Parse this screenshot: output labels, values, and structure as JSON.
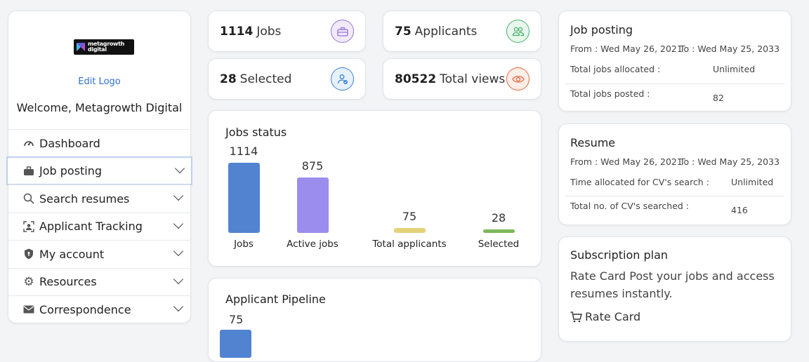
{
  "sidebar": {
    "logo_text_1": "metagrowth",
    "logo_text_2": "digital",
    "edit_logo": "Edit Logo",
    "welcome": "Welcome, Metagrowth Digital",
    "items": [
      {
        "label": "Dashboard",
        "icon": "gauge-icon"
      },
      {
        "label": "Job posting",
        "icon": "briefcase-icon"
      },
      {
        "label": "Search resumes",
        "icon": "search-icon"
      },
      {
        "label": "Applicant Tracking",
        "icon": "person-icon"
      },
      {
        "label": "My account",
        "icon": "shield-icon"
      },
      {
        "label": "Resources",
        "icon": "gear-icon"
      },
      {
        "label": "Correspondence",
        "icon": "envelope-icon"
      }
    ]
  },
  "stats": {
    "jobs": {
      "value": "1114",
      "label": "Jobs",
      "color": "#9b6fd6"
    },
    "applicants": {
      "value": "75",
      "label": "Applicants",
      "color": "#45b26b"
    },
    "selected": {
      "value": "28",
      "label": "Selected",
      "color": "#3b82d6"
    },
    "views": {
      "value": "80522",
      "label": "Total views",
      "color": "#e8663d"
    }
  },
  "jobs_status": {
    "title": "Jobs status"
  },
  "chart_data": {
    "type": "bar",
    "categories": [
      "Jobs",
      "Active jobs",
      "Total applicants",
      "Selected"
    ],
    "values": [
      1114,
      875,
      75,
      28
    ],
    "colors": [
      "#5283d1",
      "#9b8ded",
      "#e4d27a",
      "#7cb85a"
    ],
    "title": "Jobs status"
  },
  "pipeline": {
    "title": "Applicant Pipeline",
    "value": "75"
  },
  "job_posting_card": {
    "title": "Job posting",
    "from": "From : Wed May 26, 2021",
    "to": "To : Wed May 25, 2033",
    "allocated_label": "Total jobs allocated :",
    "allocated_value": "Unlimited",
    "posted_label": "Total jobs posted :",
    "posted_value": "82"
  },
  "resume_card": {
    "title": "Resume",
    "from": "From : Wed May 26, 2021",
    "to": "To : Wed May 25, 2033",
    "time_label": "Time allocated for CV's search :",
    "time_value": "Unlimited",
    "searched_label": "Total no. of CV's searched :",
    "searched_value": "416"
  },
  "subscription_card": {
    "title": "Subscription plan",
    "text": "Rate Card Post your jobs and access resumes instantly.",
    "link": "Rate Card"
  }
}
